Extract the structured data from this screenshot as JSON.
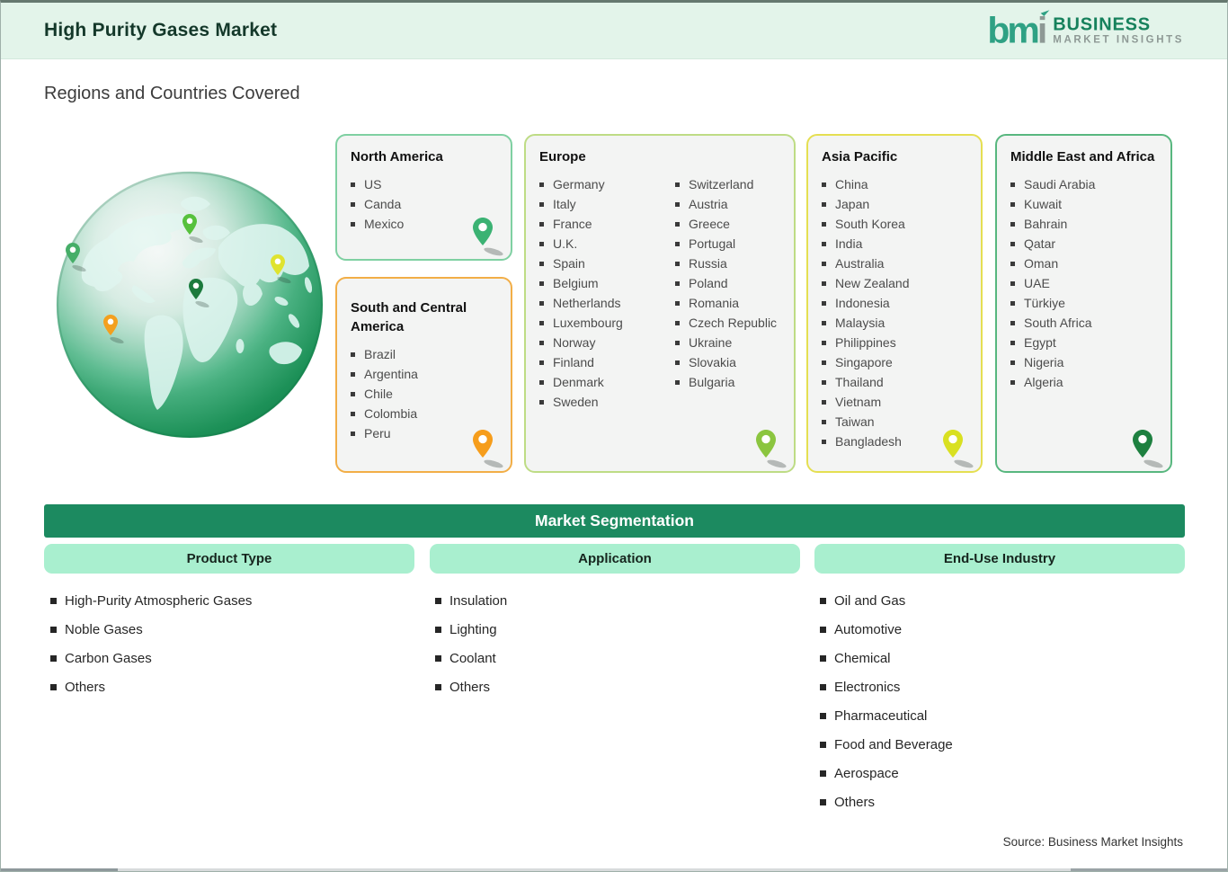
{
  "header": {
    "title": "High Purity Gases Market",
    "logo": {
      "mark_bm": "bm",
      "mark_i": "i",
      "name_line1": "BUSINESS",
      "name_line2": "MARKET INSIGHTS"
    }
  },
  "page": {
    "section_title": "Regions and Countries Covered",
    "source_note": "Source: Business Market Insights"
  },
  "colors": {
    "header_bg": "#e3f4ea",
    "brand_green_dark": "#1c8a60",
    "mint_header": "#a9efcf",
    "card_bg": "#f3f4f3"
  },
  "regions": [
    {
      "name": "North America",
      "border_color": "#7fd0a2",
      "pin_color": "#3bb273",
      "items": [
        "US",
        "Canda",
        "Mexico"
      ]
    },
    {
      "name": "South and Central America",
      "border_color": "#f2ae47",
      "pin_color": "#f69d1b",
      "items": [
        "Brazil",
        "Argentina",
        "Chile",
        "Colombia",
        "Peru"
      ]
    },
    {
      "name": "Europe",
      "border_color": "#bedc85",
      "pin_color": "#8bc53f",
      "items_left": [
        "Germany",
        "Italy",
        "France",
        "U.K.",
        "Spain",
        "Belgium",
        "Netherlands",
        "Luxembourg",
        "Norway",
        "Finland",
        "Denmark",
        "Sweden"
      ],
      "items_right": [
        "Switzerland",
        "Austria",
        "Greece",
        "Portugal",
        "Russia",
        "Poland",
        "Romania",
        "Czech Republic",
        "Ukraine",
        "Slovakia",
        "Bulgaria"
      ]
    },
    {
      "name": "Asia Pacific",
      "border_color": "#e5df52",
      "pin_color": "#d9e021",
      "items": [
        "China",
        "Japan",
        "South Korea",
        "India",
        "Australia",
        "New Zealand",
        "Indonesia",
        "Malaysia",
        "Philippines",
        "Singapore",
        "Thailand",
        "Vietnam",
        "Taiwan",
        "Bangladesh"
      ]
    },
    {
      "name": "Middle East and Africa",
      "border_color": "#58b77f",
      "pin_color": "#1e8040",
      "items": [
        "Saudi Arabia",
        "Kuwait",
        "Bahrain",
        "Qatar",
        "Oman",
        "UAE",
        "Türkiye",
        "South Africa",
        "Egypt",
        "Nigeria",
        "Algeria"
      ]
    }
  ],
  "globe": {
    "pins": [
      {
        "region": "north-america",
        "color": "#46ae68"
      },
      {
        "region": "europe",
        "color": "#57c13d"
      },
      {
        "region": "asia-pacific",
        "color": "#dfe32f"
      },
      {
        "region": "middle-east-africa",
        "color": "#1c7a3d"
      },
      {
        "region": "south-central-america",
        "color": "#f3a01f"
      }
    ]
  },
  "segmentation": {
    "title": "Market Segmentation",
    "columns": [
      {
        "header": "Product Type",
        "items": [
          "High-Purity Atmospheric Gases",
          "Noble Gases",
          "Carbon Gases",
          "Others"
        ]
      },
      {
        "header": "Application",
        "items": [
          "Insulation",
          "Lighting",
          "Coolant",
          "Others"
        ]
      },
      {
        "header": "End-Use Industry",
        "items": [
          "Oil and Gas",
          "Automotive",
          "Chemical",
          "Electronics",
          "Pharmaceutical",
          "Food and Beverage",
          "Aerospace",
          "Others"
        ]
      }
    ]
  }
}
